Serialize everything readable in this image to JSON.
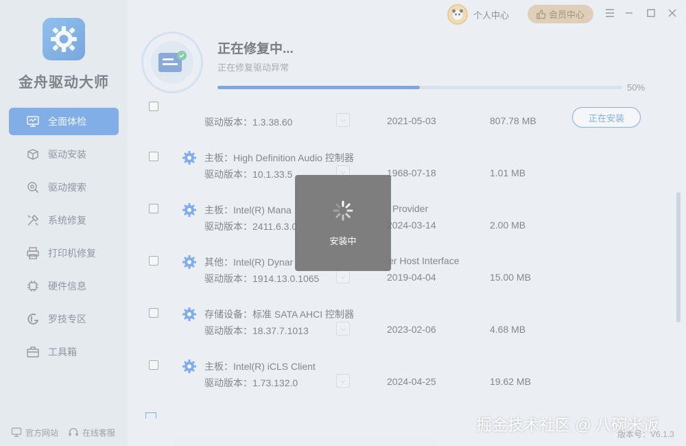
{
  "app": {
    "name": "金舟驱动大师",
    "version_label": "版本号：V6.1.3"
  },
  "titlebar": {
    "user_label": "个人中心",
    "vip_label": "会员中心"
  },
  "sidebar": {
    "items": [
      {
        "label": "全面体检",
        "icon": "monitor-icon",
        "active": true
      },
      {
        "label": "驱动安装",
        "icon": "box-icon"
      },
      {
        "label": "驱动搜索",
        "icon": "search-gear-icon"
      },
      {
        "label": "系统修复",
        "icon": "tools-icon"
      },
      {
        "label": "打印机修复",
        "icon": "printer-icon"
      },
      {
        "label": "硬件信息",
        "icon": "chip-icon"
      },
      {
        "label": "罗技专区",
        "icon": "logitech-icon"
      },
      {
        "label": "工具箱",
        "icon": "toolbox-icon"
      }
    ],
    "footer": {
      "website": "官方网站",
      "service": "在线客服"
    }
  },
  "repair": {
    "title": "正在修复中...",
    "subtitle": "正在修复驱动异常",
    "progress": 0.5,
    "progress_label": "50%"
  },
  "drivers": [
    {
      "name": "",
      "version": "驱动版本：1.3.38.60",
      "date": "2021-05-03",
      "size": "807.78 MB",
      "button": "正在安装"
    },
    {
      "name": "主板：High Definition Audio 控制器",
      "version": "驱动版本：10.1.33.5",
      "date": "1968-07-18",
      "size": "1.01 MB"
    },
    {
      "name": "主板：Intel(R) Mana",
      "name_tail": "Provider",
      "version": "驱动版本：2411.6.3.0",
      "date": "2024-03-14",
      "size": "2.00 MB"
    },
    {
      "name": "其他：Intel(R) Dynar",
      "name_tail": "er Host Interface",
      "version": "驱动版本：1914.13.0.1065",
      "date": "2019-04-04",
      "size": "15.00 MB"
    },
    {
      "name": "存储设备：标准 SATA AHCI 控制器",
      "version": "驱动版本：18.37.7.1013",
      "date": "2023-02-06",
      "size": "4.68 MB"
    },
    {
      "name": "主板：Intel(R) iCLS Client",
      "version": "驱动版本：1.73.132.0",
      "date": "2024-04-25",
      "size": "19.62 MB"
    }
  ],
  "loading": {
    "text": "安装中"
  },
  "watermark": "掘金技术社区 @ 八碗米饭",
  "colors": {
    "accent": "#2f7de1",
    "progress": "#2f6fca",
    "vip": "#d9b98a"
  }
}
